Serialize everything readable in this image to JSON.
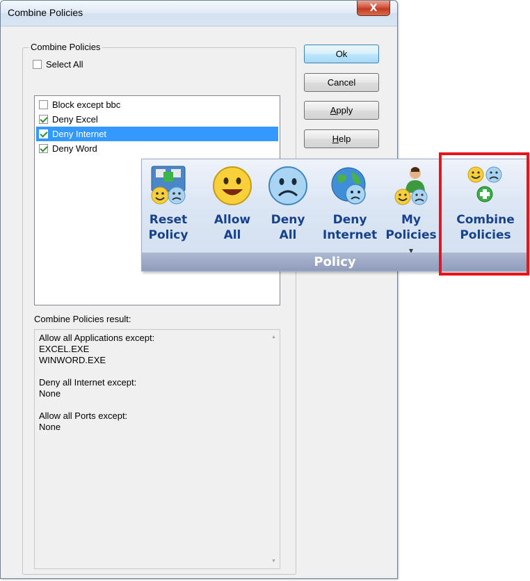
{
  "window": {
    "title": "Combine Policies",
    "close_glyph": "X"
  },
  "group": {
    "legend": "Combine Policies",
    "select_all": {
      "label": "Select All",
      "checked": false
    }
  },
  "policies": [
    {
      "label": "Block except bbc",
      "checked": false,
      "selected": false
    },
    {
      "label": "Deny Excel",
      "checked": true,
      "selected": false
    },
    {
      "label": "Deny Internet",
      "checked": true,
      "selected": true
    },
    {
      "label": "Deny Word",
      "checked": true,
      "selected": false
    }
  ],
  "result": {
    "label": "Combine Policies result:",
    "lines": [
      "Allow all Applications except:",
      "EXCEL.EXE",
      "WINWORD.EXE",
      "",
      "Deny all Internet except:",
      "None",
      "",
      "Allow all Ports except:",
      "None"
    ],
    "scroll_up": "▲",
    "scroll_down": "▼"
  },
  "buttons": {
    "ok": "Ok",
    "cancel": "Cancel",
    "apply_pre": "",
    "apply_ul": "A",
    "apply_post": "pply",
    "help_pre": "",
    "help_ul": "H",
    "help_post": "elp"
  },
  "ribbon": {
    "group_label": "Policy",
    "items": [
      {
        "line1": "Reset",
        "line2": "Policy",
        "icon": "reset-policy-icon"
      },
      {
        "line1": "Allow",
        "line2": "All",
        "icon": "happy-face-icon"
      },
      {
        "line1": "Deny",
        "line2": "All",
        "icon": "sad-face-icon"
      },
      {
        "line1": "Deny",
        "line2": "Internet",
        "icon": "globe-sad-icon"
      },
      {
        "line1": "My",
        "line2": "Policies",
        "icon": "user-policies-icon"
      },
      {
        "line1": "Combine",
        "line2": "Policies",
        "icon": "combine-policies-icon"
      }
    ],
    "dropdown_glyph": "▾"
  },
  "colors": {
    "highlight": "#e8141c",
    "ribbon_text": "#15428b",
    "selection": "#3399ff"
  }
}
